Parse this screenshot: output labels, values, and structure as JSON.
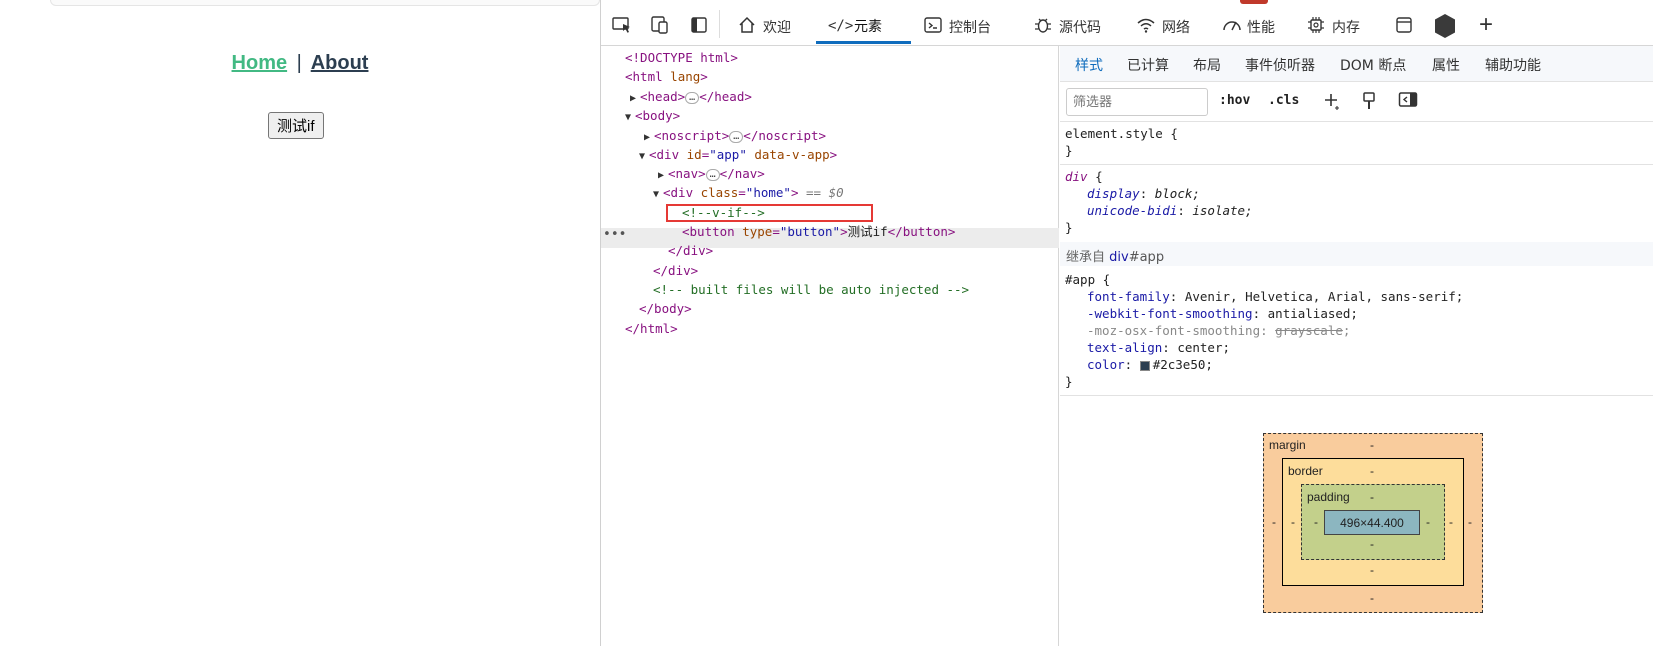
{
  "page": {
    "nav": {
      "home": "Home",
      "separator": "|",
      "about": "About"
    },
    "button_label": "测试if"
  },
  "devtools": {
    "tabs": [
      {
        "label": "欢迎",
        "icon": "home-icon"
      },
      {
        "label": "元素",
        "icon": "code-icon"
      },
      {
        "label": "控制台",
        "icon": "console-icon"
      },
      {
        "label": "源代码",
        "icon": "bug-icon"
      },
      {
        "label": "网络",
        "icon": "wifi-icon"
      },
      {
        "label": "性能",
        "icon": "gauge-icon"
      },
      {
        "label": "内存",
        "icon": "chip-icon"
      }
    ],
    "add_tab": "+",
    "dom": {
      "doctype": "<!DOCTYPE html>",
      "html_open_tag": "<html",
      "html_attr": " lang",
      "html_close_bracket": ">",
      "head_open": "<head>",
      "head_close": "</head>",
      "body_open": "<body>",
      "noscript_open": "<noscript>",
      "noscript_close": "</noscript>",
      "div_app_open": "<div",
      "div_app_attr1": " id",
      "div_app_val1": "\"app\"",
      "div_app_attr2": " data-v-app",
      "div_app_close": ">",
      "nav_open": "<nav>",
      "nav_close": "</nav>",
      "div_home_open": "<div",
      "div_home_attr": " class",
      "div_home_val": "\"home\"",
      "div_home_close": ">",
      "selected_marker": " == $0",
      "vif_comment": "<!--v-if-->",
      "button_open": "<button",
      "button_attr": " type",
      "button_val": "\"button\"",
      "button_gt": ">",
      "button_text": "测试if",
      "button_close": "</button>",
      "div_close1": "</div>",
      "div_close2": "</div>",
      "built_comment": "<!-- built files will be auto injected -->",
      "body_close": "</body>",
      "html_close": "</html>",
      "ellipsis": "…",
      "row_dots": "•••"
    },
    "styles": {
      "subtabs": [
        "样式",
        "已计算",
        "布局",
        "事件侦听器",
        "DOM 断点",
        "属性",
        "辅助功能"
      ],
      "filter_placeholder": "筛选器",
      "hov": ":hov",
      "cls": ".cls",
      "element_style_sel": "element.style {",
      "close_brace": "}",
      "div_sel": "div",
      "div_brace": " {",
      "div_props": [
        {
          "name": "display",
          "value": "block;"
        },
        {
          "name": "unicode-bidi",
          "value": "isolate;"
        }
      ],
      "inherited_prefix": "继承自 ",
      "inherited_link": "div",
      "inherited_suffix": "#app",
      "app_sel": "#app {",
      "app_props": [
        {
          "name": "font-family",
          "value": "Avenir, Helvetica, Arial, sans-serif;"
        },
        {
          "name": "-webkit-font-smoothing",
          "value": "antialiased;"
        },
        {
          "name": "-moz-osx-font-smoothing",
          "value": "grayscale"
        },
        {
          "name": "text-align",
          "value": "center;"
        },
        {
          "name": "color",
          "value": "#2c3e50;"
        }
      ],
      "colon": ": ",
      "semicolon": ";",
      "swatch_color": "#2c3e50"
    },
    "box_model": {
      "margin_label": "margin",
      "border_label": "border",
      "padding_label": "padding",
      "content": "496×44.400",
      "dash": "-"
    }
  }
}
